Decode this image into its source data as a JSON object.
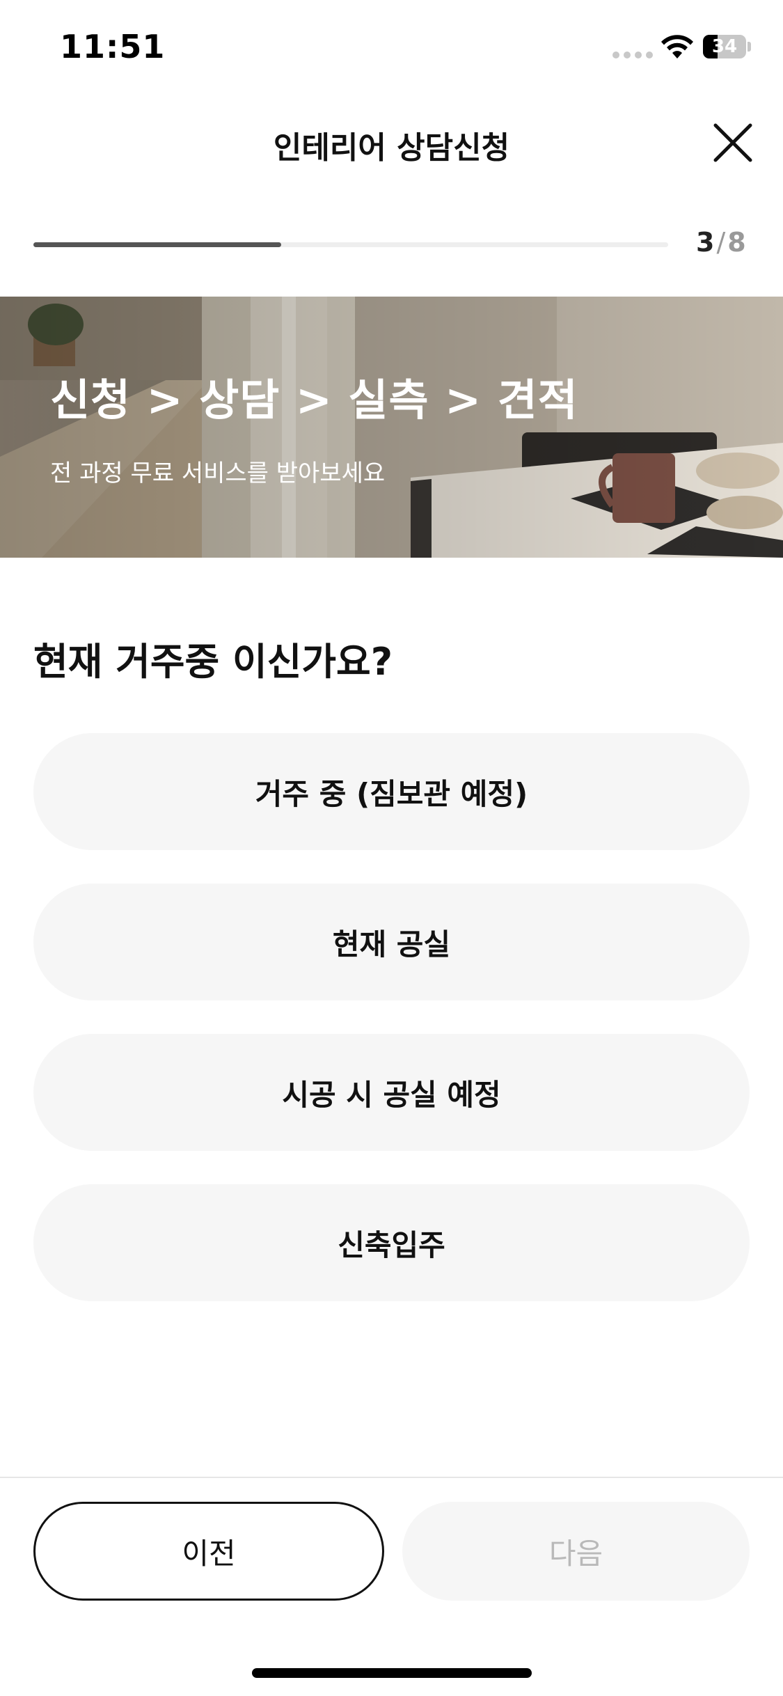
{
  "status_bar": {
    "time": "11:51",
    "battery_level": "34",
    "battery_fraction": 0.34,
    "icons": [
      "signal-icon",
      "wifi-icon",
      "battery-icon"
    ]
  },
  "header": {
    "title": "인테리어 상담신청",
    "close_icon": "close-icon"
  },
  "progress": {
    "current_step": "3",
    "separator": "/",
    "total_steps": "8",
    "fraction": 0.39
  },
  "hero": {
    "title": "신청 > 상담 > 실측 > 견적",
    "subtitle": "전 과정 무료 서비스를 받아보세요"
  },
  "question": {
    "text": "현재 거주중 이신가요?"
  },
  "options": [
    {
      "label": "거주 중 (짐보관 예정)"
    },
    {
      "label": "현재 공실"
    },
    {
      "label": "시공 시 공실 예정"
    },
    {
      "label": "신축입주"
    }
  ],
  "footer": {
    "prev_label": "이전",
    "next_label": "다음"
  },
  "colors": {
    "accent": "#555555",
    "option_bg": "#f6f6f6",
    "disabled_text": "#b9b9b9"
  }
}
